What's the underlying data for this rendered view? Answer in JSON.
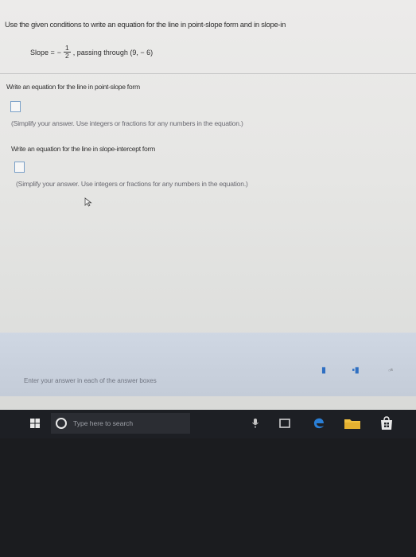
{
  "question": {
    "instruction": "Use the given conditions to write an equation for the line in point-slope form and in slope-in",
    "slope_label": "Slope =",
    "slope_sign": "−",
    "slope_numerator": "1",
    "slope_denominator": "2",
    "passing_text": ", passing through (9, − 6)"
  },
  "part1": {
    "prompt": "Write an equation for the line in point-slope form",
    "hint": "(Simplify your answer. Use integers or fractions for any numbers in the equation.)"
  },
  "part2": {
    "prompt": "Write an equation for the line in slope-intercept form",
    "hint": "(Simplify your answer. Use integers or fractions for any numbers in the equation.)"
  },
  "footer": {
    "instruction": "Enter your answer in each of the answer boxes"
  },
  "taskbar": {
    "search_placeholder": "Type here to search"
  },
  "colors": {
    "accent": "#2f6fc2",
    "edge_blue": "#2a7fd6",
    "taskbar": "#1d1f24"
  }
}
